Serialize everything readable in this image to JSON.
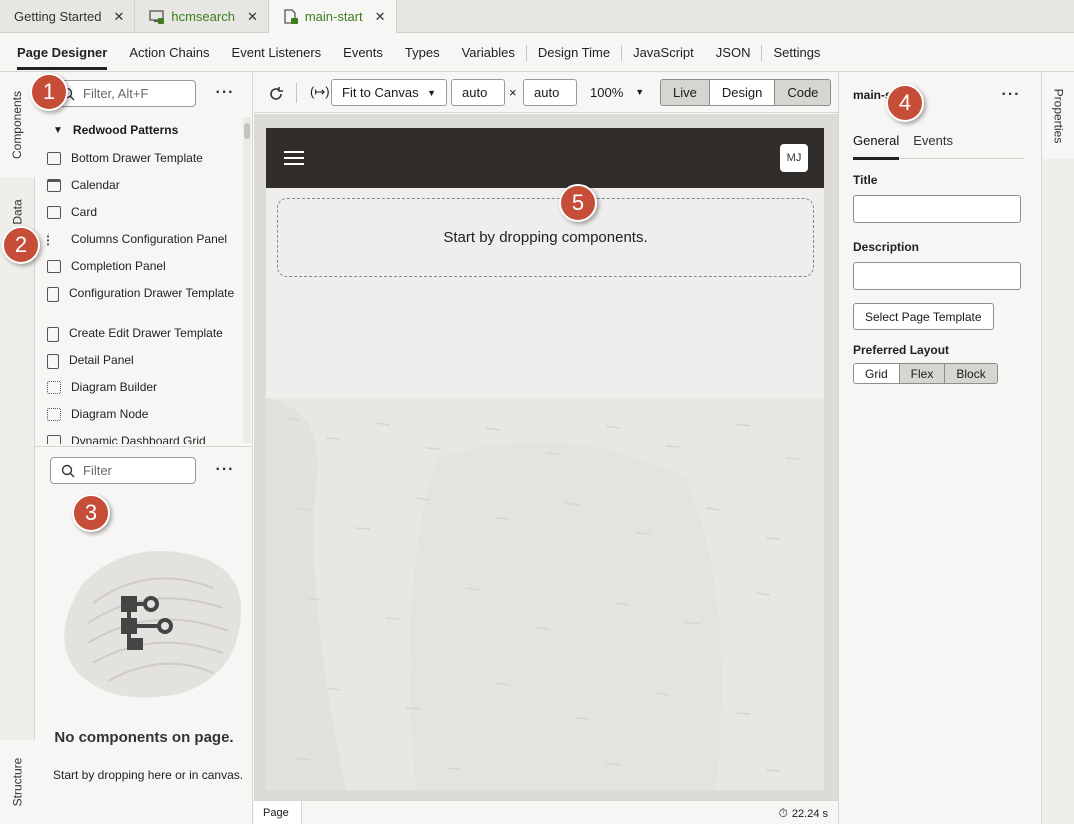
{
  "tabs": [
    {
      "label": "Getting Started",
      "icon": "none"
    },
    {
      "label": "hcmsearch",
      "icon": "app-icon"
    },
    {
      "label": "main-start",
      "icon": "page-icon"
    }
  ],
  "designer_tabs": [
    "Page Designer",
    "Action Chains",
    "Event Listeners",
    "Events",
    "Types",
    "Variables",
    "Design Time",
    "JavaScript",
    "JSON",
    "Settings"
  ],
  "left_rail": {
    "components": "Components",
    "data": "Data",
    "structure": "Structure"
  },
  "components": {
    "filter_placeholder": "Filter, Alt+F",
    "group": "Redwood Patterns",
    "items": [
      "Bottom Drawer Template",
      "Calendar",
      "Card",
      "Columns Configuration Panel",
      "Completion Panel",
      "Configuration Drawer Template",
      "Create Edit Drawer Template",
      "Detail Panel",
      "Diagram Builder",
      "Diagram Node",
      "Dynamic Dashboard Grid"
    ]
  },
  "structure": {
    "filter_placeholder": "Filter",
    "empty_title": "No components on page.",
    "empty_sub": "Start by dropping here or in canvas."
  },
  "toolbar": {
    "fit": "Fit to Canvas",
    "width": "auto",
    "times": "×",
    "height": "auto",
    "zoom": "100%",
    "modes": [
      "Live",
      "Design",
      "Code"
    ],
    "selected_mode": "Design"
  },
  "canvas": {
    "avatar": "MJ",
    "drop_text": "Start by dropping components."
  },
  "status": {
    "crumb": "Page",
    "time": "22.24 s"
  },
  "properties": {
    "title": "main-s",
    "tabs": [
      "General",
      "Events"
    ],
    "title_label": "Title",
    "description_label": "Description",
    "template_button": "Select Page Template",
    "layout_label": "Preferred Layout",
    "layouts": [
      "Grid",
      "Flex",
      "Block"
    ],
    "selected_layout": "Grid",
    "rail_label": "Properties"
  },
  "callouts": [
    "1",
    "2",
    "3",
    "4",
    "5"
  ],
  "colors": {
    "badge": "#c64d38",
    "header": "#312d2a",
    "accent_green": "#3c7d22"
  }
}
